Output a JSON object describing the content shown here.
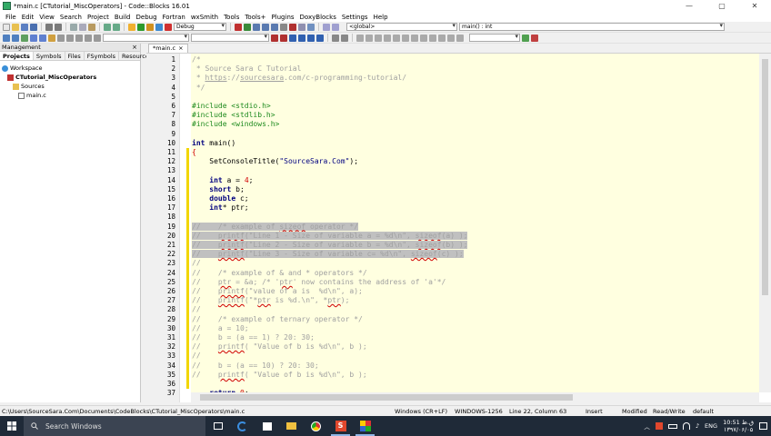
{
  "window": {
    "title": "*main.c [CTutorial_MiscOperators] - Code::Blocks 16.01",
    "controls": [
      "—",
      "▢",
      "✕"
    ]
  },
  "menu": [
    "File",
    "Edit",
    "View",
    "Search",
    "Project",
    "Build",
    "Debug",
    "Fortran",
    "wxSmith",
    "Tools",
    "Tools+",
    "Plugins",
    "DoxyBlocks",
    "Settings",
    "Help"
  ],
  "toolbar": {
    "build_target": "Debug",
    "scope": "<global>",
    "function": "main() : int"
  },
  "management": {
    "title": "Management",
    "close": "×",
    "tabs": [
      "Projects",
      "Symbols",
      "Files",
      "FSymbols",
      "Resources"
    ],
    "active_tab": "Projects",
    "tree": [
      {
        "label": "Workspace",
        "level": 0
      },
      {
        "label": "CTutorial_MiscOperators",
        "level": 1
      },
      {
        "label": "Sources",
        "level": 2
      },
      {
        "label": "main.c",
        "level": 3
      }
    ]
  },
  "editor": {
    "tab_label": "*main.c",
    "tab_close": "×",
    "lines": [
      {
        "n": "1",
        "html": "<span class='cm'>/*</span>"
      },
      {
        "n": "2",
        "html": "<span class='cm'> * Source Sara C Tutorial</span>"
      },
      {
        "n": "3",
        "html": "<span class='cm'> * <u>https</u>://<u>sourcesara</u>.com/c-programming-tutorial/</span>"
      },
      {
        "n": "4",
        "html": "<span class='cm'> */</span>"
      },
      {
        "n": "5",
        "html": ""
      },
      {
        "n": "6",
        "html": "<span class='pp'>#include &lt;stdio.h&gt;</span>"
      },
      {
        "n": "7",
        "html": "<span class='pp'>#include &lt;stdlib.h&gt;</span>"
      },
      {
        "n": "8",
        "html": "<span class='pp'>#include &lt;windows.h&gt;</span>"
      },
      {
        "n": "9",
        "html": ""
      },
      {
        "n": "10",
        "html": "<span class='kw'>int</span> main()"
      },
      {
        "n": "11",
        "html": "<span style='color:#d00000'>{</span>"
      },
      {
        "n": "12",
        "html": "    SetConsoleTitle(<span class='str'>\"SourceSara.Com\"</span>);"
      },
      {
        "n": "13",
        "html": ""
      },
      {
        "n": "14",
        "html": "    <span class='kw'>int</span> a = <span class='num'>4</span>;"
      },
      {
        "n": "15",
        "html": "    <span class='kw'>short</span> b;"
      },
      {
        "n": "16",
        "html": "    <span class='kw'>double</span> c;"
      },
      {
        "n": "17",
        "html": "    <span class='kw'>int</span>* ptr;"
      },
      {
        "n": "18",
        "html": ""
      },
      {
        "n": "19",
        "html": "<span class='sel cm'>//    /* example of <span class='sq'>sizeof</span> operator */</span>"
      },
      {
        "n": "20",
        "html": "<span class='sel cm'>//    <span class='sq'>printf</span>(\"Line 1 - Size of variable a = %d\\n\", <span class='sq'>sizeof</span>(a) );</span>"
      },
      {
        "n": "21",
        "html": "<span class='sel cm'>//    <span class='sq'>printf</span>(\"Line 2 - Size of variable b = %d\\n\", <span class='sq'>sizeof</span>(b) );</span>"
      },
      {
        "n": "22",
        "html": "<span class='sel cm'>//    <span class='sq'>printf</span>(\"Line 3 - Size of variable c= %d\\n\", <span class='sq'>sizeof</span>(c) );</span>"
      },
      {
        "n": "23",
        "html": "<span class='cm'>//</span>"
      },
      {
        "n": "24",
        "html": "<span class='cm'>//    /* example of &amp; and * operators */</span>"
      },
      {
        "n": "25",
        "html": "<span class='cm'>//    <span class='sq'>ptr</span> = &amp;a; /* '<span class='sq'>ptr</span>' now contains the address of 'a'*/</span>"
      },
      {
        "n": "26",
        "html": "<span class='cm'>//    <span class='sq'>printf</span>(\"value of a is  %d\\n\", a);</span>"
      },
      {
        "n": "27",
        "html": "<span class='cm'>//    <span class='sq'>printf</span>(\"*<span class='sq'>ptr</span> is %d.\\n\", *<span class='sq'>ptr</span>);</span>"
      },
      {
        "n": "28",
        "html": "<span class='cm'>//</span>"
      },
      {
        "n": "29",
        "html": "<span class='cm'>//    /* example of ternary operator */</span>"
      },
      {
        "n": "30",
        "html": "<span class='cm'>//    a = 10;</span>"
      },
      {
        "n": "31",
        "html": "<span class='cm'>//    b = (a == 1) ? 20: 30;</span>"
      },
      {
        "n": "32",
        "html": "<span class='cm'>//    <span class='sq'>printf</span>( \"Value of b is %d\\n\", b );</span>"
      },
      {
        "n": "33",
        "html": "<span class='cm'>//</span>"
      },
      {
        "n": "34",
        "html": "<span class='cm'>//    b = (a == 10) ? 20: 30;</span>"
      },
      {
        "n": "35",
        "html": "<span class='cm'>//    <span class='sq'>printf</span>( \"Value of b is %d\\n\", b );</span>"
      },
      {
        "n": "36",
        "html": ""
      },
      {
        "n": "37",
        "html": "    <span class='kw'>return</span> <span class='num'>0</span>;"
      }
    ]
  },
  "status": {
    "path": "C:\\Users\\SourceSara.Com\\Documents\\CodeBlocks\\CTutorial_MiscOperators\\main.c",
    "eol": "Windows (CR+LF)",
    "encoding": "WINDOWS-1256",
    "position": "Line 22, Column 63",
    "mode": "Insert",
    "modified": "Modified",
    "access": "Read/Write",
    "profile": "default"
  },
  "taskbar": {
    "search_placeholder": "Search Windows",
    "lang": "ENG",
    "time": "10:51 ق.ظ",
    "date": "۱۳۹۷/۰۶/۰۵"
  }
}
